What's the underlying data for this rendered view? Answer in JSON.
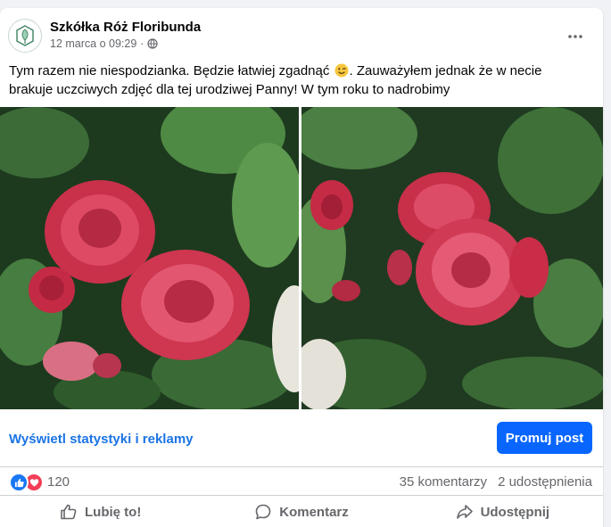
{
  "post": {
    "page_name": "Szkółka Róż Floribunda",
    "date": "12 marca o 09:29",
    "separator": "·",
    "text_part1": "Tym razem nie niespodzianka. Będzie łatwiej zgadnąć ",
    "text_part2": ". Zauważyłem jednak że w necie brakuje uczciwych zdjęć dla tej urodziwej Panny!  W tym roku to nadrobimy",
    "emoji": "winking-face-icon",
    "images": [
      {
        "description": "red-roses-photo-left"
      },
      {
        "description": "red-roses-photo-right"
      }
    ]
  },
  "promo": {
    "stats_link": "Wyświetl statystyki i reklamy",
    "promote_button": "Promuj post"
  },
  "engagement": {
    "reaction_icons": [
      "like-icon",
      "love-icon"
    ],
    "reaction_count": "120",
    "comments": "35 komentarzy",
    "shares": "2 udostępnienia"
  },
  "actions": {
    "like": "Lubię to!",
    "comment": "Komentarz",
    "share": "Udostępnij"
  },
  "colors": {
    "primary_blue": "#0866ff",
    "link_blue": "#1b74e4",
    "secondary_text": "#65676b",
    "like_blue": "#1877f2",
    "love_red": "#f33e58",
    "rose_red": "#d9354f"
  }
}
